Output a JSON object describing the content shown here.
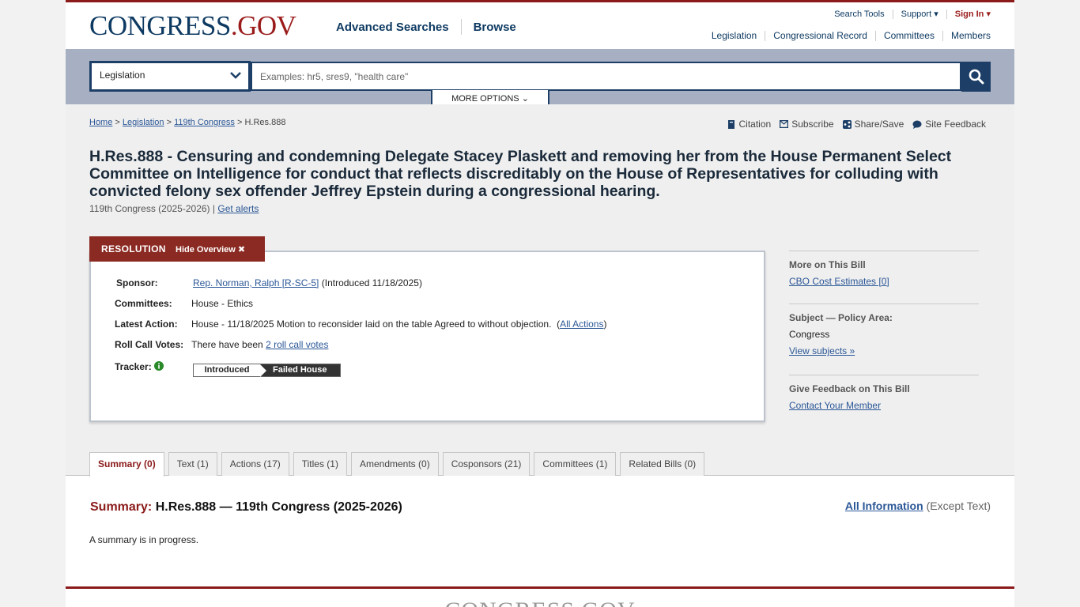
{
  "header": {
    "logo_main": "CONGRESS",
    "logo_accent": ".GOV",
    "nav": [
      "Advanced Searches",
      "Browse"
    ],
    "utility": [
      "Search Tools",
      "Support",
      "Sign In"
    ],
    "secondary": [
      "Legislation",
      "Congressional Record",
      "Committees",
      "Members"
    ]
  },
  "search": {
    "scope": "Legislation",
    "placeholder": "Examples: hr5, sres9, \"health care\"",
    "more_options": "MORE OPTIONS"
  },
  "breadcrumb": {
    "home": "Home",
    "legislation": "Legislation",
    "congress": "119th Congress",
    "sep": ">",
    "current": "H.Res.888"
  },
  "tools": [
    "Citation",
    "Subscribe",
    "Share/Save",
    "Site Feedback"
  ],
  "bill": {
    "title": "H.Res.888 - Censuring and condemning Delegate Stacey Plaskett and removing her from the House Permanent Select Committee on Intelligence for conduct that reflects discreditably on the House of Representatives for colluding with convicted felony sex offender Jeffrey Epstein during a congressional hearing.",
    "congress": "119th Congress (2025-2026)",
    "sep": "|",
    "alerts": "Get alerts"
  },
  "overview": {
    "type_label": "RESOLUTION",
    "hide_label": "Hide Overview",
    "sponsor_label": "Sponsor:",
    "sponsor_name": "Rep. Norman, Ralph [R-SC-5]",
    "sponsor_intro": "(Introduced 11/18/2025)",
    "committees_label": "Committees:",
    "committees_value": "House - Ethics",
    "latest_label": "Latest Action:",
    "latest_value": "House - 11/18/2025 Motion to reconsider laid on the table Agreed to without objection.",
    "all_actions_open": "(",
    "all_actions": "All Actions",
    "all_actions_close": ")",
    "rollcall_label": "Roll Call Votes:",
    "rollcall_prefix": "There have been",
    "rollcall_link": "2 roll call votes",
    "tracker_label": "Tracker:",
    "tracker_steps": [
      "Introduced",
      "Failed House"
    ]
  },
  "sidebar": {
    "more_heading": "More on This Bill",
    "cbo": "CBO Cost Estimates [0]",
    "subject_heading": "Subject — Policy Area:",
    "subject_value": "Congress",
    "view_subjects": "View subjects",
    "feedback_heading": "Give Feedback on This Bill",
    "contact": "Contact Your Member"
  },
  "tabs": [
    "Summary (0)",
    "Text (1)",
    "Actions (17)",
    "Titles (1)",
    "Amendments (0)",
    "Cosponsors (21)",
    "Committees (1)",
    "Related Bills (0)"
  ],
  "summary": {
    "label": "Summary:",
    "heading": "H.Res.888 — 119th Congress (2025-2026)",
    "all_info": "All Information",
    "except": "(Except Text)",
    "text": "A summary is in progress."
  },
  "footer": {
    "logo": "CONGRESS.GOV"
  },
  "colors": {
    "brand_navy": "#0e3a62",
    "brand_red": "#9b1b1b",
    "search_band": "#a6b0c2"
  }
}
